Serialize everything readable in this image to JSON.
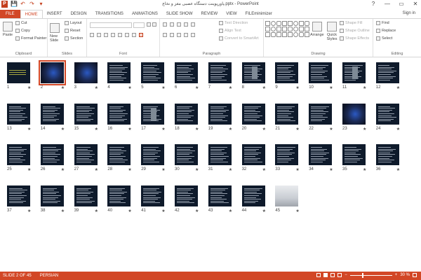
{
  "window": {
    "title": "پاورپوینت دستگاه عصبی مغز و نخاع.pptx - PowerPoint",
    "help": "?",
    "minimize": "—",
    "restore": "▭",
    "close": "✕",
    "sign_in": "Sign in"
  },
  "qat": {
    "logo": "P",
    "save": "💾",
    "undo": "↶",
    "redo": "↷",
    "customize": "▾"
  },
  "tabs": [
    "FILE",
    "HOME",
    "INSERT",
    "DESIGN",
    "TRANSITIONS",
    "ANIMATIONS",
    "SLIDE SHOW",
    "REVIEW",
    "VIEW",
    "FILEminimizer"
  ],
  "active_tab": "HOME",
  "ribbon": {
    "clipboard": {
      "label": "Clipboard",
      "paste": "Paste",
      "cut": "Cut",
      "copy": "Copy",
      "format_painter": "Format Painter"
    },
    "slides": {
      "label": "Slides",
      "new_slide": "New Slide",
      "layout": "Layout",
      "reset": "Reset",
      "section": "Section"
    },
    "font": {
      "label": "Font"
    },
    "paragraph": {
      "label": "Paragraph",
      "text_direction": "Text Direction",
      "align_text": "Align Text",
      "smartart": "Convert to SmartArt"
    },
    "drawing": {
      "label": "Drawing",
      "arrange": "Arrange",
      "quick_styles": "Quick Styles",
      "shape_fill": "Shape Fill",
      "shape_outline": "Shape Outline",
      "shape_effects": "Shape Effects"
    },
    "editing": {
      "label": "Editing",
      "find": "Find",
      "replace": "Replace",
      "select": "Select"
    }
  },
  "slides": [
    {
      "n": "1",
      "kind": "title"
    },
    {
      "n": "2",
      "kind": "brain",
      "selected": true
    },
    {
      "n": "3",
      "kind": "brain"
    },
    {
      "n": "4"
    },
    {
      "n": "5"
    },
    {
      "n": "6"
    },
    {
      "n": "7"
    },
    {
      "n": "8",
      "kind": "image"
    },
    {
      "n": "9"
    },
    {
      "n": "10"
    },
    {
      "n": "11",
      "kind": "image"
    },
    {
      "n": "12"
    },
    {
      "n": "13"
    },
    {
      "n": "14"
    },
    {
      "n": "15"
    },
    {
      "n": "16"
    },
    {
      "n": "17",
      "kind": "image"
    },
    {
      "n": "18"
    },
    {
      "n": "19"
    },
    {
      "n": "20"
    },
    {
      "n": "21"
    },
    {
      "n": "22"
    },
    {
      "n": "23",
      "kind": "brain"
    },
    {
      "n": "24"
    },
    {
      "n": "25"
    },
    {
      "n": "26"
    },
    {
      "n": "27"
    },
    {
      "n": "28"
    },
    {
      "n": "29"
    },
    {
      "n": "30"
    },
    {
      "n": "31"
    },
    {
      "n": "32"
    },
    {
      "n": "33"
    },
    {
      "n": "34"
    },
    {
      "n": "35"
    },
    {
      "n": "36"
    },
    {
      "n": "37"
    },
    {
      "n": "38"
    },
    {
      "n": "39"
    },
    {
      "n": "40"
    },
    {
      "n": "41"
    },
    {
      "n": "42"
    },
    {
      "n": "43"
    },
    {
      "n": "44"
    },
    {
      "n": "45",
      "kind": "photo"
    }
  ],
  "slide_star": "★",
  "status": {
    "slide_info": "SLIDE 2 OF 45",
    "language": "PERSIAN",
    "zoom_minus": "−",
    "zoom_plus": "+",
    "zoom": "30 %",
    "zoom_level": 0.3
  },
  "colors": {
    "accent": "#d24726",
    "thumb_bg": "#0e1a2b"
  }
}
